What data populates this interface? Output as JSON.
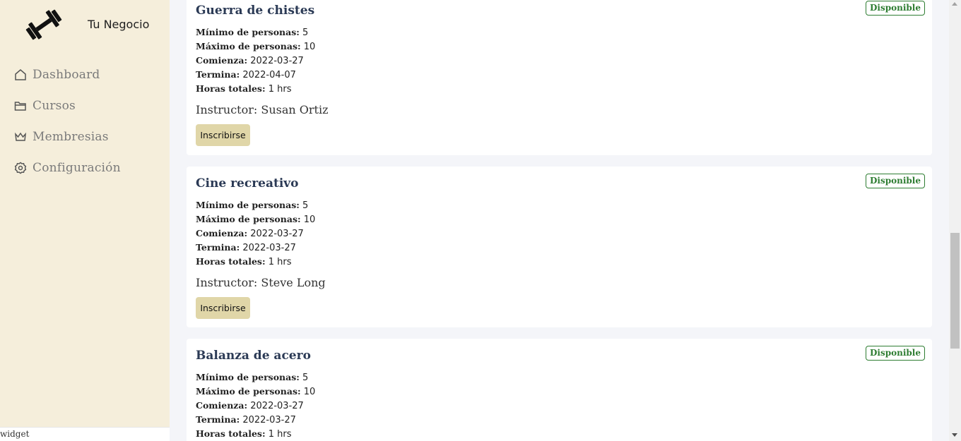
{
  "brand": {
    "name": "Tu Negocio",
    "logo_icon": "dumbbell-icon"
  },
  "sidebar": {
    "items": [
      {
        "label": "Dashboard",
        "icon": "home-icon"
      },
      {
        "label": "Cursos",
        "icon": "folder-icon"
      },
      {
        "label": "Membresias",
        "icon": "crown-icon"
      },
      {
        "label": "Configuración",
        "icon": "gear-icon"
      }
    ]
  },
  "status_bar": {
    "text": "widget"
  },
  "labels": {
    "min": "Mínimo de personas:",
    "max": "Máximo de personas:",
    "start": "Comienza:",
    "end": "Termina:",
    "hours": "Horas totales:",
    "enroll": "Inscribirse",
    "status": "Disponible"
  },
  "courses": [
    {
      "title": "Guerra de chistes",
      "status": "Disponible",
      "min": "5",
      "max": "10",
      "start": "2022-03-27",
      "end": "2022-04-07",
      "hours": "1 hrs",
      "instructor": "Instructor: Susan Ortiz",
      "button": "Inscribirse"
    },
    {
      "title": "Cine recreativo",
      "status": "Disponible",
      "min": "5",
      "max": "10",
      "start": "2022-03-27",
      "end": "2022-03-27",
      "hours": "1 hrs",
      "instructor": "Instructor: Steve Long",
      "button": "Inscribirse"
    },
    {
      "title": "Balanza de acero",
      "status": "Disponible",
      "min": "5",
      "max": "10",
      "start": "2022-03-27",
      "end": "2022-03-27",
      "hours": "1 hrs"
    }
  ],
  "colors": {
    "sidebar_bg": "#f5eedb",
    "badge_green": "#2e7d32",
    "button_bg": "#e0d6a8",
    "title_blue": "#2b3a55"
  }
}
